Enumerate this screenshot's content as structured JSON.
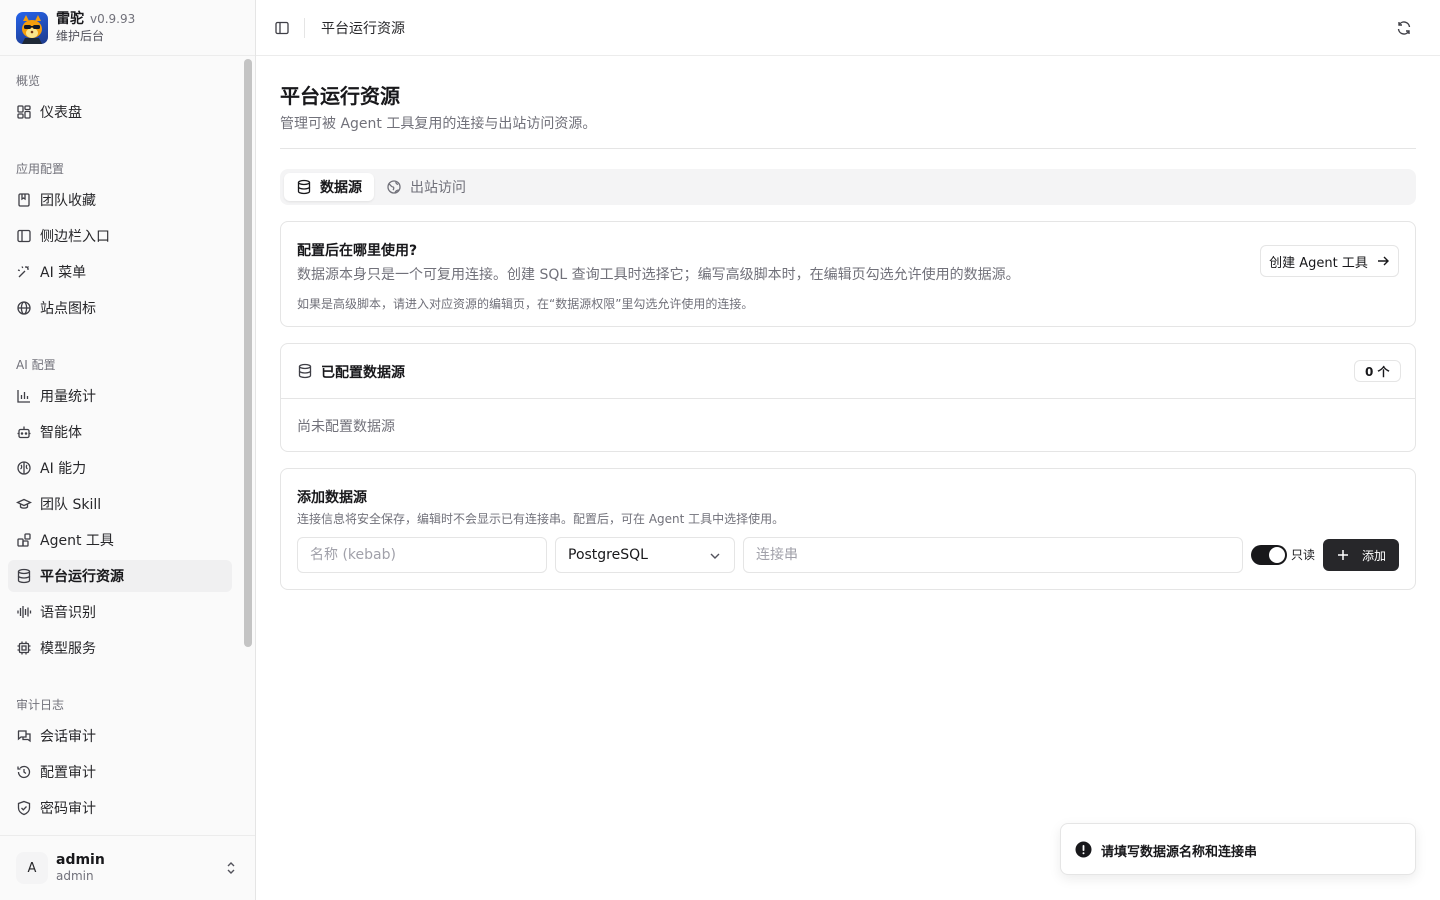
{
  "brand": {
    "name": "雷驼",
    "version": "v0.9.93",
    "subtitle": "维护后台"
  },
  "sidebar": {
    "groups": [
      {
        "label": "概览"
      },
      {
        "label": "应用配置"
      },
      {
        "label": "AI 配置"
      },
      {
        "label": "审计日志"
      }
    ],
    "items": [
      {
        "label": "仪表盘",
        "icon": "dashboard-icon"
      },
      {
        "label": "团队收藏",
        "icon": "bookmark-icon"
      },
      {
        "label": "侧边栏入口",
        "icon": "sidebar-panel-icon"
      },
      {
        "label": "AI 菜单",
        "icon": "sparkle-icon"
      },
      {
        "label": "站点图标",
        "icon": "globe-icon"
      },
      {
        "label": "用量统计",
        "icon": "bar-chart-icon"
      },
      {
        "label": "智能体",
        "icon": "bot-icon"
      },
      {
        "label": "AI 能力",
        "icon": "brain-icon"
      },
      {
        "label": "团队 Skill",
        "icon": "graduation-cap-icon"
      },
      {
        "label": "Agent 工具",
        "icon": "blocks-icon"
      },
      {
        "label": "平台运行资源",
        "icon": "database-icon",
        "active": true
      },
      {
        "label": "语音识别",
        "icon": "audio-wave-icon"
      },
      {
        "label": "模型服务",
        "icon": "cpu-icon"
      },
      {
        "label": "会话审计",
        "icon": "messages-icon"
      },
      {
        "label": "配置审计",
        "icon": "history-icon"
      },
      {
        "label": "密码审计",
        "icon": "shield-check-icon"
      }
    ]
  },
  "user": {
    "avatar": "A",
    "name": "admin",
    "role": "admin"
  },
  "topbar": {
    "breadcrumb": "平台运行资源"
  },
  "page": {
    "title": "平台运行资源",
    "subtitle": "管理可被 Agent 工具复用的连接与出站访问资源。"
  },
  "tabs": [
    {
      "label": "数据源",
      "icon": "database-icon",
      "active": true
    },
    {
      "label": "出站访问",
      "icon": "globe-icon",
      "active": false
    }
  ],
  "usage_card": {
    "title": "配置后在哪里使用?",
    "desc": "数据源本身只是一个可复用连接。创建 SQL 查询工具时选择它；编写高级脚本时，在编辑页勾选允许使用的数据源。",
    "note": "如果是高级脚本，请进入对应资源的编辑页，在“数据源权限”里勾选允许使用的连接。",
    "button_label": "创建 Agent 工具"
  },
  "configured_card": {
    "title": "已配置数据源",
    "count": "0 个",
    "empty_text": "尚未配置数据源"
  },
  "add_card": {
    "title": "添加数据源",
    "desc": "连接信息将安全保存，编辑时不会显示已有连接串。配置后，可在 Agent 工具中选择使用。",
    "name_placeholder": "名称 (kebab)",
    "name_value": "",
    "type_value": "PostgreSQL",
    "conn_placeholder": "连接串",
    "conn_value": "",
    "readonly_label": "只读",
    "readonly_on": true,
    "add_label": "添加"
  },
  "toast": {
    "message": "请填写数据源名称和连接串"
  },
  "colors": {
    "accent": "#18181b",
    "sidebar_bg": "#fafafa",
    "border": "#e5e5e5",
    "muted": "#71717a"
  }
}
